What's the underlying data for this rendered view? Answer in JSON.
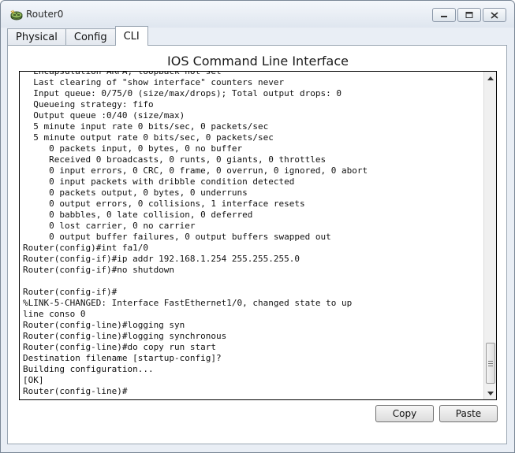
{
  "window": {
    "title": "Router0",
    "icon": "router-icon",
    "controls": [
      "minimize-icon",
      "maximize-icon",
      "close-icon"
    ]
  },
  "tabs": [
    {
      "label": "Physical",
      "active": false
    },
    {
      "label": "Config",
      "active": false
    },
    {
      "label": "CLI",
      "active": true
    }
  ],
  "cli": {
    "heading": "IOS Command Line Interface",
    "lines": [
      "  Encapsulation ARPA, loopback not set",
      "  Last clearing of \"show interface\" counters never",
      "  Input queue: 0/75/0 (size/max/drops); Total output drops: 0",
      "  Queueing strategy: fifo",
      "  Output queue :0/40 (size/max)",
      "  5 minute input rate 0 bits/sec, 0 packets/sec",
      "  5 minute output rate 0 bits/sec, 0 packets/sec",
      "     0 packets input, 0 bytes, 0 no buffer",
      "     Received 0 broadcasts, 0 runts, 0 giants, 0 throttles",
      "     0 input errors, 0 CRC, 0 frame, 0 overrun, 0 ignored, 0 abort",
      "     0 input packets with dribble condition detected",
      "     0 packets output, 0 bytes, 0 underruns",
      "     0 output errors, 0 collisions, 1 interface resets",
      "     0 babbles, 0 late collision, 0 deferred",
      "     0 lost carrier, 0 no carrier",
      "     0 output buffer failures, 0 output buffers swapped out",
      "Router(config)#int fa1/0",
      "Router(config-if)#ip addr 192.168.1.254 255.255.255.0",
      "Router(config-if)#no shutdown",
      "",
      "Router(config-if)#",
      "%LINK-5-CHANGED: Interface FastEthernet1/0, changed state to up",
      "line conso 0",
      "Router(config-line)#logging syn",
      "Router(config-line)#logging synchronous",
      "Router(config-line)#do copy run start",
      "Destination filename [startup-config]?",
      "Building configuration...",
      "[OK]",
      "Router(config-line)#"
    ],
    "scroll_position": 0.9
  },
  "buttons": {
    "copy": "Copy",
    "paste": "Paste"
  }
}
